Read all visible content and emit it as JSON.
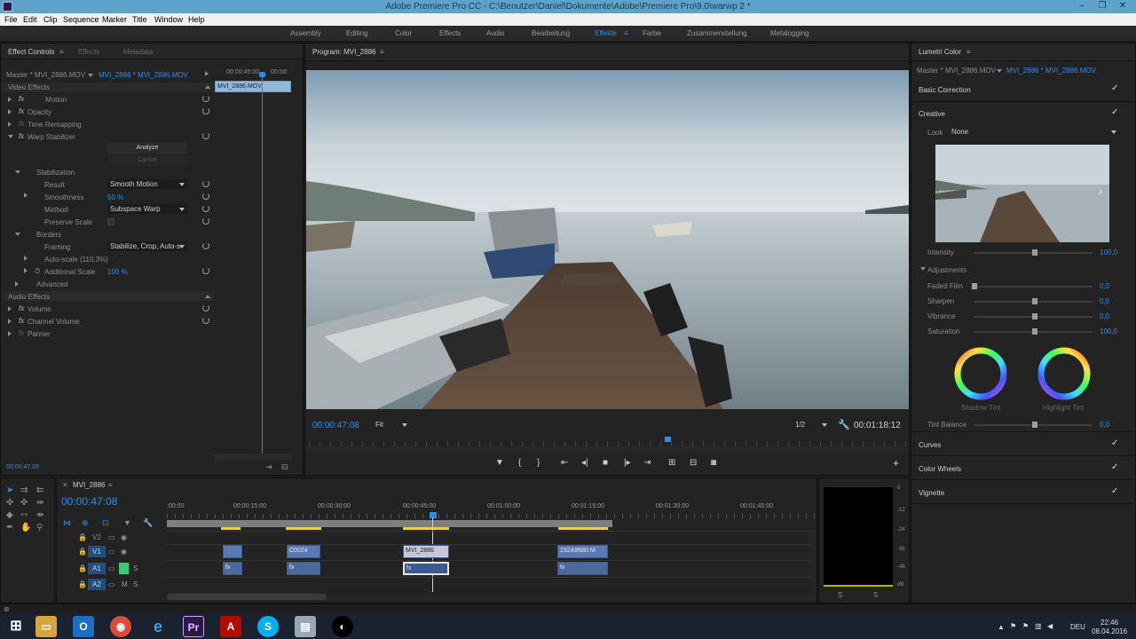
{
  "window": {
    "title": "Adobe Premiere Pro CC - C:\\Benutzer\\Daniel\\Dokumente\\Adobe\\Premiere Pro\\9.0\\warwp 2 *"
  },
  "menu": [
    "File",
    "Edit",
    "Clip",
    "Sequence",
    "Marker",
    "Title",
    "Window",
    "Help"
  ],
  "workspaces": [
    "Assembly",
    "Editing",
    "Color",
    "Effects",
    "Audio",
    "Bearbeitung",
    "Effekte",
    "Farbe",
    "Zusammenstellung",
    "Metalogging"
  ],
  "active_workspace": "Effekte",
  "effect_controls": {
    "tabs": [
      "Effect Controls",
      "Effects",
      "Metadata"
    ],
    "master": "Master * MVI_2886.MOV",
    "clip": "MVI_2886 * MVI_2886.MOV",
    "mini_tc_1": "00:00:45:00",
    "mini_tc_2": "00:00:",
    "mini_clip": "MVI_2886.MOV",
    "video_effects": "Video Effects",
    "motion": "Motion",
    "opacity": "Opacity",
    "time_remapping": "Time Remapping",
    "warp": "Warp Stabilizer",
    "analyze": "Analyze",
    "cancel": "Cancel",
    "stabilization": "Stabilization",
    "result_label": "Result",
    "result_value": "Smooth Motion",
    "smoothness_label": "Smoothness",
    "smoothness_value": "50 %",
    "method_label": "Method",
    "method_value": "Subspace Warp",
    "preserve_scale": "Preserve Scale",
    "borders": "Borders",
    "framing_label": "Framing",
    "framing_value": "Stabilize, Crop, Auto-s",
    "auto_scale": "Auto-scale (110,3%)",
    "additional_scale_label": "Additional Scale",
    "additional_scale_value": "100 %",
    "advanced": "Advanced",
    "audio_effects": "Audio Effects",
    "volume": "Volume",
    "channel_volume": "Channel Volume",
    "panner": "Panner",
    "timecode": "00:00:47:08"
  },
  "program": {
    "title": "Program: MVI_2886",
    "timecode": "00:00:47:08",
    "fit": "Fit",
    "resolution": "1/2",
    "duration": "00:01:18:12"
  },
  "lumetri": {
    "title": "Lumetri Color",
    "master": "Master * MVI_2886.MOV",
    "clip": "MVI_2886 * MVI_2886.MOV",
    "basic_correction": "Basic Correction",
    "creative": "Creative",
    "look_label": "Look",
    "look_value": "None",
    "intensity_label": "Intensity",
    "intensity_value": "100,0",
    "intensity_level": 0.5,
    "adjustments": "Adjustments",
    "faded_film_label": "Faded Film",
    "faded_film_value": "0,0",
    "sharpen_label": "Sharpen",
    "sharpen_value": "0,0",
    "vibrance_label": "Vibrance",
    "vibrance_value": "0,0",
    "saturation_label": "Saturation",
    "saturation_value": "100,0",
    "shadow_tint": "Shadow Tint",
    "highlight_tint": "Highlight Tint",
    "tint_balance_label": "Tint Balance",
    "tint_balance_value": "0,0",
    "curves": "Curves",
    "color_wheels": "Color Wheels",
    "vignette": "Vignette"
  },
  "timeline": {
    "sequence": "MVI_2886",
    "timecode": "00:00:47:08",
    "ruler": [
      ":00:00",
      "00:00:15:00",
      "00:00:30:00",
      "00:00:45:00",
      "00:01:00:00",
      "00:01:15:00",
      "00:01:30:00",
      "00:01:45:00"
    ],
    "tracks": [
      "V2",
      "V1",
      "A1",
      "A2"
    ],
    "clips": [
      "C0024",
      "MVI_2886",
      "232A9680.M"
    ],
    "meter_scale": [
      "0",
      "-12",
      "-24",
      "-36",
      "-48",
      "dB"
    ],
    "meter_solo": [
      "S",
      "S"
    ]
  },
  "taskbar": {
    "time": "22:46",
    "date": "08.04.2016",
    "lang": "DEU"
  }
}
